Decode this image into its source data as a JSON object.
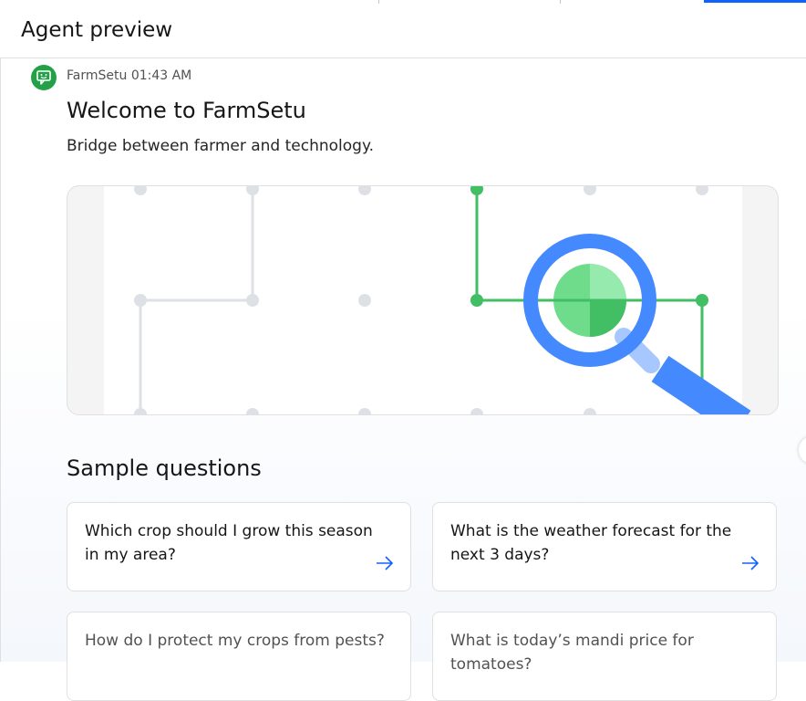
{
  "panel": {
    "title": "Agent preview"
  },
  "message": {
    "sender": "FarmSetu",
    "time": "01:43 AM",
    "title": "Welcome to FarmSetu",
    "subtitle": "Bridge between farmer and technology."
  },
  "sample": {
    "heading": "Sample questions",
    "questions": [
      {
        "text": "Which crop should I grow this season in my area?"
      },
      {
        "text": "What is the weather forecast for the next 3 days?"
      },
      {
        "text": "How do I protect my crops from pests?"
      },
      {
        "text": "What is today’s mandi price for tomatoes?"
      }
    ]
  },
  "colors": {
    "accent": "#0f62fe",
    "avatar": "#24a148",
    "green": "#42be65",
    "magnifier": "#4589ff",
    "arrow": "#0f62fe"
  },
  "icons": {
    "avatar": "chat-bot-icon",
    "card_arrow": "arrow-right-icon"
  }
}
